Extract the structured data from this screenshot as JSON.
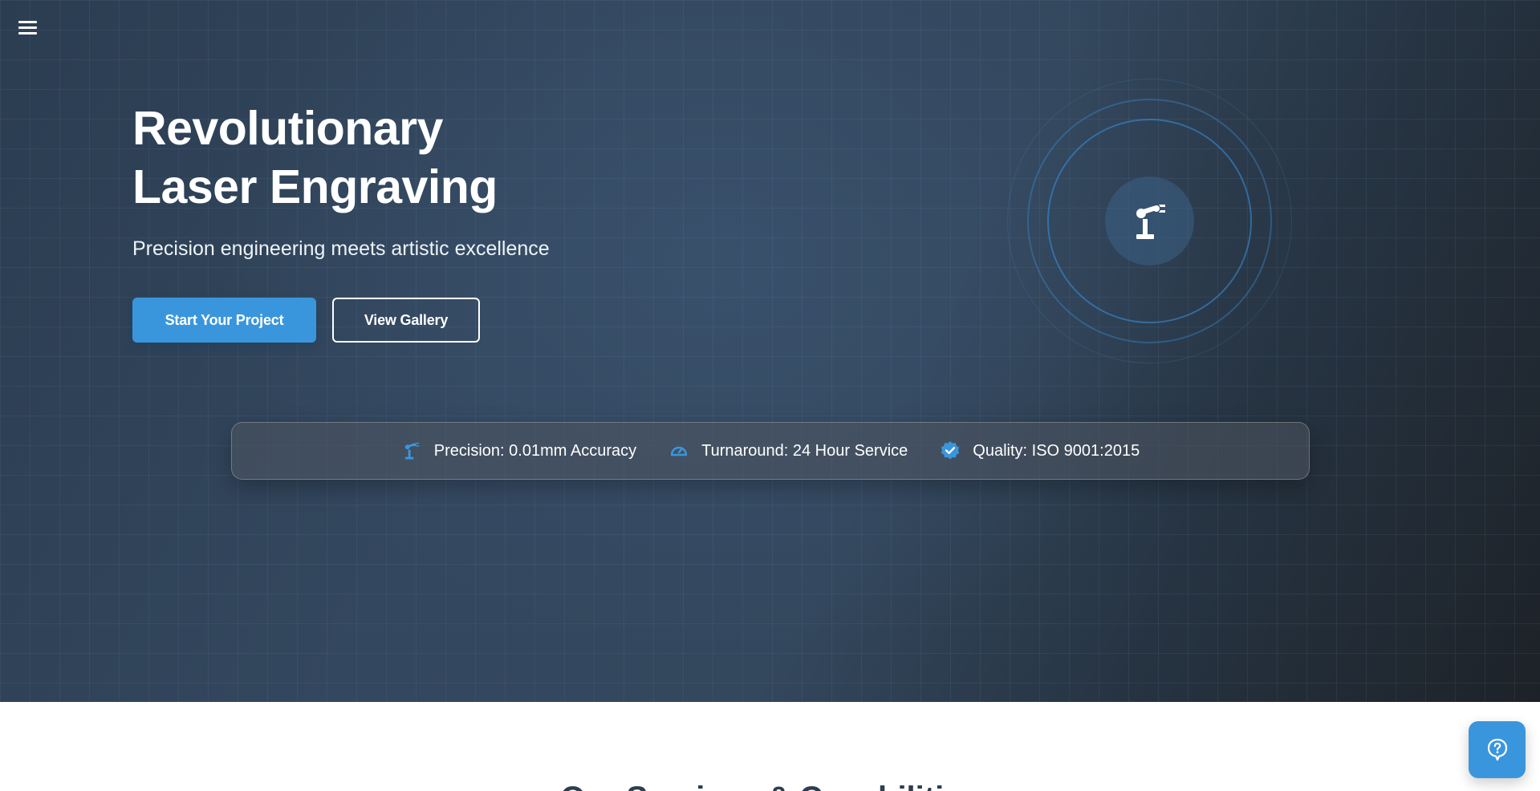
{
  "nav": {
    "menu_icon": "hamburger-menu-icon"
  },
  "hero": {
    "title_line1": "Revolutionary",
    "title_line2": "Laser Engraving",
    "subtitle": "Precision engineering meets artistic excellence",
    "primary_button": "Start Your Project",
    "secondary_button": "View Gallery",
    "graphic_icon": "robot-arm-icon"
  },
  "stats": [
    {
      "icon": "robot-arm-icon",
      "label": "Precision: 0.01mm Accuracy"
    },
    {
      "icon": "speedometer-icon",
      "label": "Turnaround: 24 Hour Service"
    },
    {
      "icon": "verified-badge-icon",
      "label": "Quality: ISO 9001:2015"
    }
  ],
  "next_section": {
    "title": "Our Services & Capabilities"
  },
  "help": {
    "icon": "help-question-icon"
  },
  "colors": {
    "accent": "#3a96dc",
    "hero_dark": "#2b3d51",
    "text_light": "#ffffff"
  }
}
